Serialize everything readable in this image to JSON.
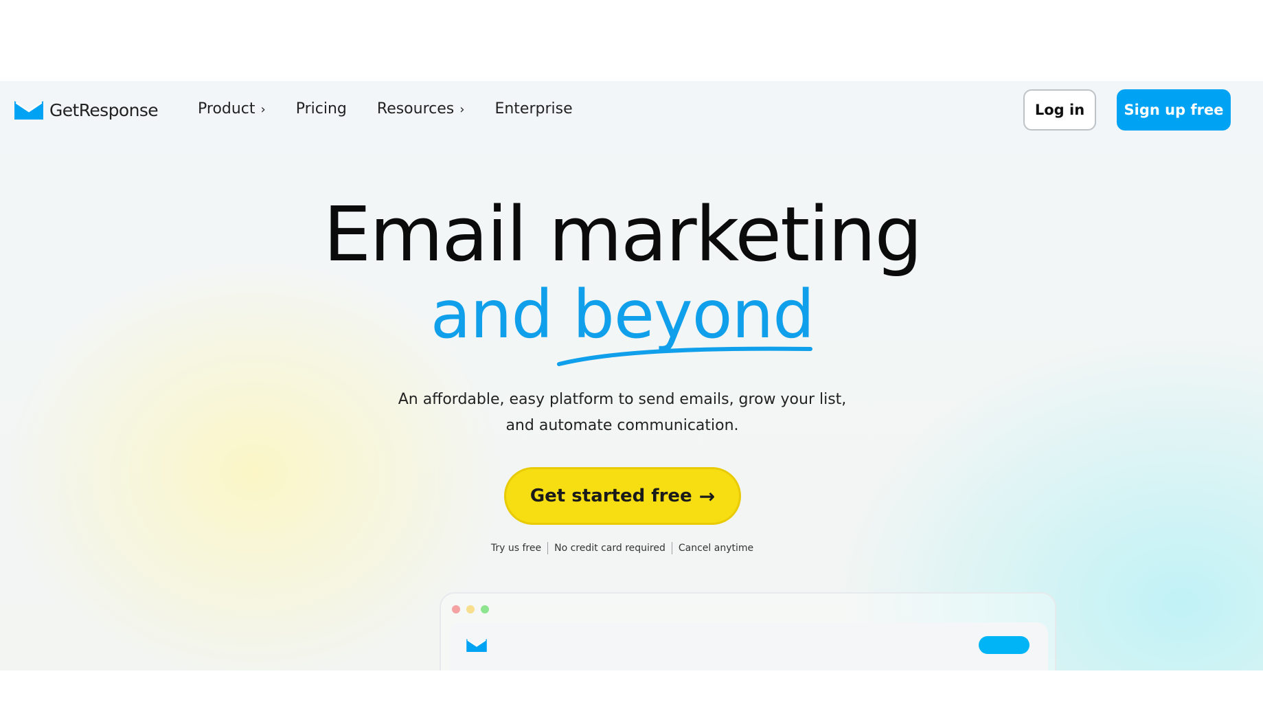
{
  "brand": {
    "name": "GetResponse",
    "accent_color": "#00a2f4",
    "cta_color": "#f7de13"
  },
  "nav": {
    "items": [
      {
        "label": "Product",
        "has_chevron": true,
        "chevron": "›"
      },
      {
        "label": "Pricing",
        "has_chevron": false
      },
      {
        "label": "Resources",
        "has_chevron": true,
        "chevron": "›"
      },
      {
        "label": "Enterprise",
        "has_chevron": false
      }
    ],
    "login_label": "Log in",
    "signup_label": "Sign up free"
  },
  "hero": {
    "title_line1": "Email marketing",
    "title_line2": "and beyond",
    "subtitle_line1": "An affordable, easy platform to send emails, grow your list,",
    "subtitle_line2": "and automate communication.",
    "cta_label": "Get started free",
    "cta_icon": "arrow-right-icon",
    "cta_arrow": "→",
    "trust_items": [
      "Try us free",
      "No credit card required",
      "Cancel anytime"
    ]
  }
}
